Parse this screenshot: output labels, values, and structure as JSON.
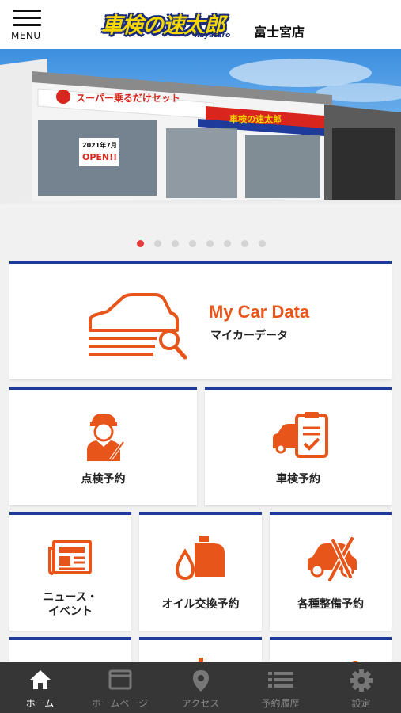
{
  "header": {
    "menu_label": "MENU",
    "logo_text": "車検の速太郎",
    "logo_sub": "hayataro",
    "store_name": "富士宮店"
  },
  "hero": {
    "signs": [
      "スーパー乗るだけセット",
      "2021年7月",
      "OPEN!!",
      "車検の速太郎"
    ],
    "slide_count": 8,
    "active_slide": 1
  },
  "tiles": {
    "mycar": {
      "title": "My Car Data",
      "subtitle": "マイカーデータ",
      "icon": "car-magnifier-icon"
    },
    "inspection": {
      "label": "点検予約",
      "icon": "mechanic-icon"
    },
    "shaken": {
      "label": "車検予約",
      "icon": "car-clipboard-icon"
    },
    "news": {
      "label_line1": "ニュース・",
      "label_line2": "イベント",
      "icon": "newspaper-icon"
    },
    "oil": {
      "label": "オイル交換予約",
      "icon": "oil-can-icon"
    },
    "maintenance": {
      "label": "各種整備予約",
      "icon": "car-tools-icon"
    }
  },
  "bottom_nav": [
    {
      "label": "ホーム",
      "icon": "home-icon",
      "active": true
    },
    {
      "label": "ホームページ",
      "icon": "browser-icon",
      "active": false
    },
    {
      "label": "アクセス",
      "icon": "map-pin-icon",
      "active": false
    },
    {
      "label": "予約履歴",
      "icon": "list-icon",
      "active": false
    },
    {
      "label": "設定",
      "icon": "gear-icon",
      "active": false
    }
  ],
  "colors": {
    "accent": "#e8551a",
    "card_border": "#1e3a9a",
    "nav_bg": "#363636"
  }
}
